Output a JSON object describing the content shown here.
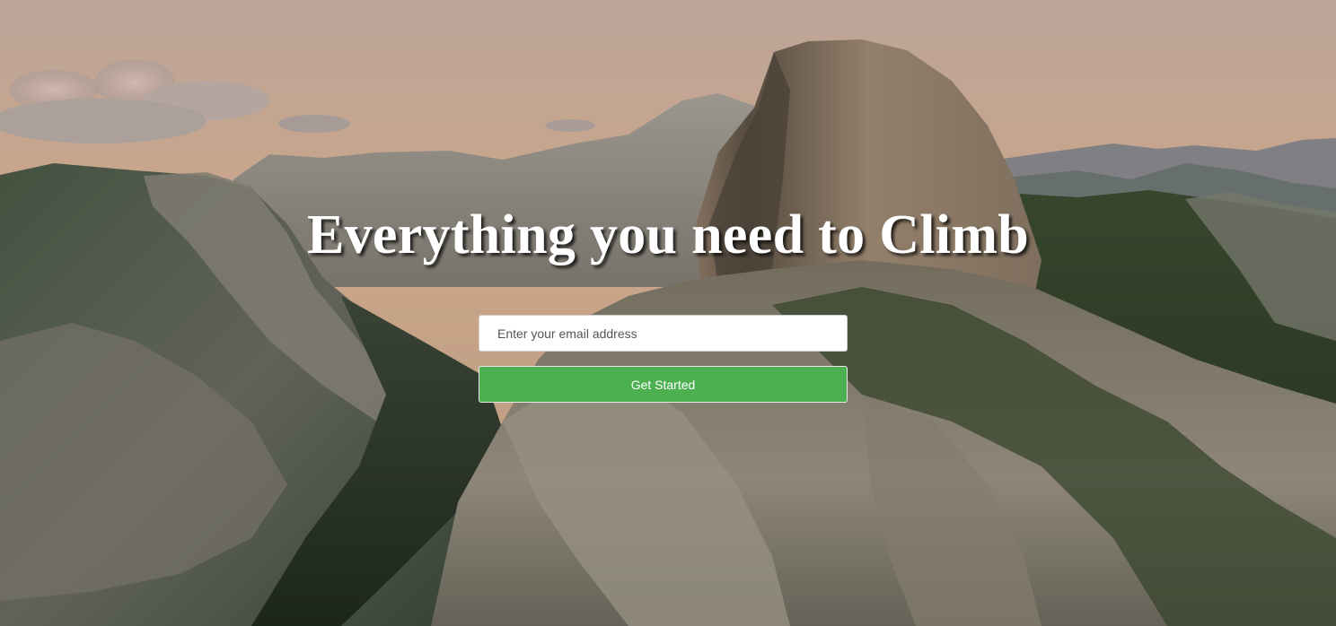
{
  "hero": {
    "headline": "Everything you need to Climb",
    "background": "mountain-landscape-photo"
  },
  "signup": {
    "email_placeholder": "Enter your email address",
    "email_value": "",
    "button_label": "Get Started"
  },
  "colors": {
    "button_bg": "#4caf50",
    "button_text": "#ffffff",
    "headline_text": "#ffffff",
    "input_bg": "#ffffff"
  }
}
